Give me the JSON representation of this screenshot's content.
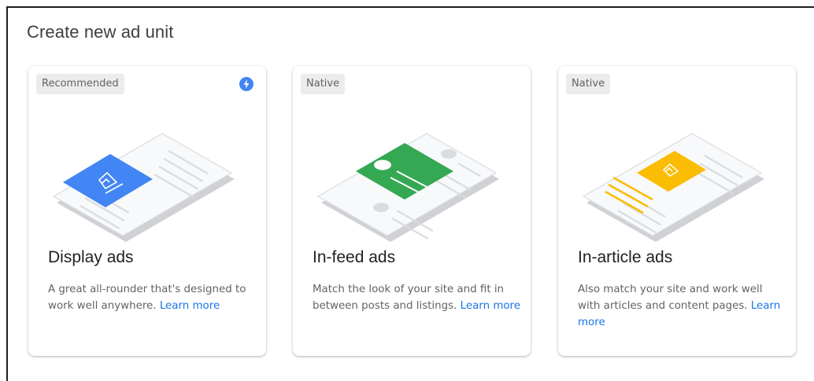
{
  "page": {
    "title": "Create new ad unit"
  },
  "cards": [
    {
      "badge": "Recommended",
      "title": "Display ads",
      "description": "A great all-rounder that's designed to work well anywhere.",
      "link": "Learn more",
      "accent": "#4285f4",
      "icon": "bolt-icon"
    },
    {
      "badge": "Native",
      "title": "In-feed ads",
      "description": "Match the look of your site and fit in between posts and listings.",
      "link": "Learn more",
      "accent": "#34a853"
    },
    {
      "badge": "Native",
      "title": "In-article ads",
      "description": "Also match your site and work well with articles and content pages.",
      "link": "Learn more",
      "accent": "#fbbc04"
    }
  ],
  "colors": {
    "link": "#1a73e8",
    "badge_bg": "#ececec",
    "text_secondary": "#5f6368"
  }
}
